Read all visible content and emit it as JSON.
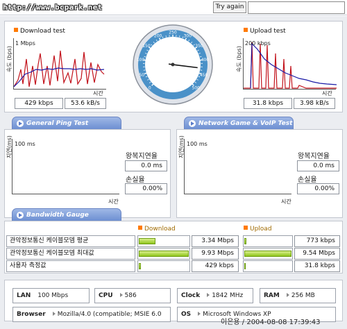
{
  "header": {
    "url": "http://www.bcpark.net",
    "try_again_label": "Try again"
  },
  "download": {
    "title": "Download test",
    "y_axis": "속도 (bps)",
    "scale": "1 Mbps",
    "x_axis": "시간",
    "kbps": "429 kbps",
    "kBs": "53.6 kB/s"
  },
  "upload": {
    "title": "Upload test",
    "y_axis": "속도 (bps)",
    "scale": "200 kbps",
    "x_axis": "시간",
    "kbps": "31.8 kbps",
    "kBs": "3.98 kB/s"
  },
  "gauge": {
    "labels": [
      "0",
      "50",
      "100",
      "150",
      "200",
      "250",
      "300",
      "350",
      "400",
      "450",
      "500"
    ],
    "needle_fraction": 0.86
  },
  "tabs": {
    "ping": "General Ping Test",
    "game": "Network Game & VoIP Test",
    "bandwidth": "Bandwidth Gauge"
  },
  "ping_left": {
    "y_axis": "지연(ms)",
    "scale": "100 ms",
    "x_axis": "시간",
    "rtt_label": "왕복지연율",
    "rtt_value": "0.0 ms",
    "loss_label": "손실율",
    "loss_value": "0.00%"
  },
  "ping_right": {
    "y_axis": "지연(ms)",
    "scale": "100 ms",
    "x_axis": "시간",
    "rtt_label": "왕복지연율",
    "rtt_value": "0.0 ms",
    "loss_label": "손실율",
    "loss_value": "0.00%"
  },
  "bandwidth": {
    "download_header": "Download",
    "upload_header": "Upload",
    "rows": [
      {
        "label": "관악정보통신 케이블모뎀 평균",
        "download": "3.34 Mbps",
        "download_fill": 0.34,
        "upload": "773 kbps",
        "upload_fill": 0.05
      },
      {
        "label": "관악정보통신 케이블모뎀 최대값",
        "download": "9.93 Mbps",
        "download_fill": 1.0,
        "upload": "9.54 Mbps",
        "upload_fill": 1.0
      },
      {
        "label": "사용자 측정값",
        "download": "429 kbps",
        "download_fill": 0.04,
        "upload": "31.8 kbps",
        "upload_fill": 0.01
      }
    ]
  },
  "system": {
    "lan_label": "LAN",
    "lan_value": "100 Mbps",
    "cpu_label": "CPU",
    "cpu_value": "586",
    "clock_label": "Clock",
    "clock_value": "1842 MHz",
    "ram_label": "RAM",
    "ram_value": "256 MB",
    "browser_label": "Browser",
    "browser_value": "Mozilla/4.0 (compatible; MSIE 6.0",
    "os_label": "OS",
    "os_value": "Microsoft Windows XP"
  },
  "stamp": "이은용 / 2004-08-08 17:39:43",
  "colors": {
    "download_line": "#1a1aa6",
    "download_spike": "#c2121b",
    "bar_fill": "#8fc51b",
    "tab": "#6d8fd2",
    "accent": "#ff7a00"
  }
}
